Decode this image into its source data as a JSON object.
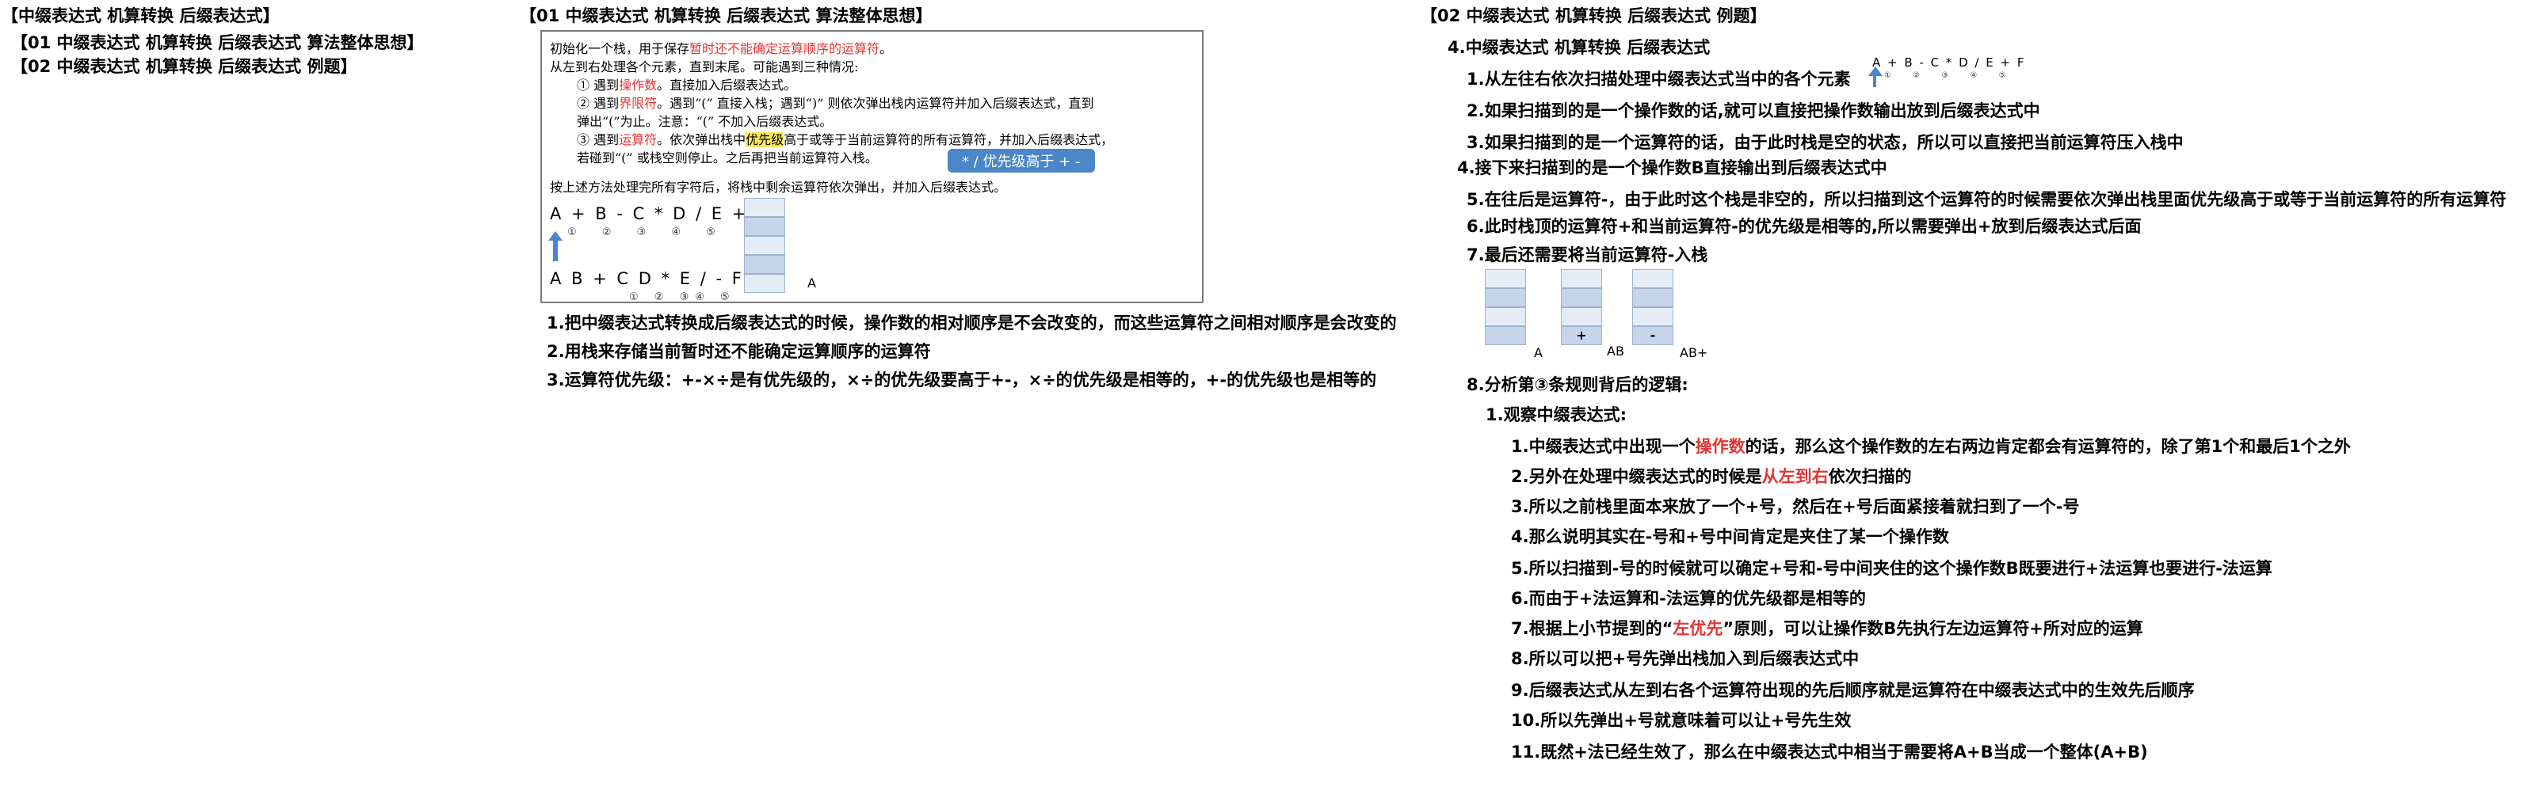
{
  "left": {
    "title": "【中缀表达式 机算转换 后缀表达式】",
    "items": [
      "【01 中缀表达式 机算转换 后缀表达式 算法整体思想】",
      "【02 中缀表达式 机算转换 后缀表达式 例题】"
    ]
  },
  "mid": {
    "title": "【01 中缀表达式 机算转换 后缀表达式 算法整体思想】",
    "panel": {
      "l1a": "初始化一个栈，用于保存",
      "l1b": "暂时还不能确定运算顺序的运算符",
      "l1c": "。",
      "l2": "从左到右处理各个元素，直到末尾。可能遇到三种情况:",
      "l3a": "① 遇到",
      "l3b": "操作数",
      "l3c": "。直接加入后缀表达式。",
      "l4a": "② 遇到",
      "l4b": "界限符",
      "l4c": "。遇到“(” 直接入栈；遇到“)” 则依次弹出栈内运算符并加入后缀表达式，直到",
      "l5": "弹出“(”为止。注意：“(” 不加入后缀表达式。",
      "l6a": "③ 遇到",
      "l6b": "运算符",
      "l6c": "。依次弹出栈中",
      "l6d": "优先级",
      "l6e": "高于或等于当前运算符的所有运算符，并加入后缀表达式，",
      "l7": "若碰到“(” 或栈空则停止。之后再把当前运算符入栈。",
      "tip": "* / 优先级高于 + -",
      "l8": "按上述方法处理完所有字符后，将栈中剩余运算符依次弹出，并加入后缀表达式。",
      "expr1": "A + B - C * D / E + F",
      "expr1_marks": "① ② ③ ④ ⑤",
      "expr2": "A B + C D * E / - F +",
      "expr2_marks": "① ② ③④ ⑤",
      "stack_label": "A"
    },
    "notes": [
      "1.把中缀表达式转换成后缀表达式的时候，操作数的相对顺序是不会改变的，而这些运算符之间相对顺序是会改变的",
      "2.用栈来存储当前暂时还不能确定运算顺序的运算符",
      "3.运算符优先级：+-×÷是有优先级的，×÷的优先级要高于+-，×÷的优先级是相等的，+-的优先级也是相等的"
    ]
  },
  "right": {
    "title": "【02 中缀表达式 机算转换 后缀表达式 例题】",
    "h4": "4.中缀表达式 机算转换 后缀表达式",
    "s1": "1.从左往右依次扫描处理中缀表达式当中的各个元素",
    "mini_expr": "A + B - C * D / E + F",
    "mini_marks": "① ② ③ ④ ⑤",
    "s2": "2.如果扫描到的是一个操作数的话,就可以直接把操作数输出放到后缀表达式中",
    "s3": "3.如果扫描到的是一个运算符的话，由于此时栈是空的状态，所以可以直接把当前运算符压入栈中",
    "s4": "4.接下来扫描到的是一个操作数B直接输出到后缀表达式中",
    "s5": "5.在往后是运算符-，由于此时这个栈是非空的，所以扫描到这个运算符的时候需要依次弹出栈里面优先级高于或等于当前运算符的所有运算符",
    "s6": "6.此时栈顶的运算符+和当前运算符-的优先级是相等的,所以需要弹出+放到后缀表达式后面",
    "s7": "7.最后还需要将当前运算符-入栈",
    "stk1_label": "A",
    "stk2_top": "+",
    "stk2_label": "AB",
    "stk3_top": "-",
    "stk3_label": "AB+",
    "s8": "8.分析第③条规则背后的逻辑:",
    "s8_1": "1.观察中缀表达式:",
    "d1a": "1.中缀表达式中出现一个",
    "d1b": "操作数",
    "d1c": "的话，那么这个操作数的左右两边肯定都会有运算符的，除了第1个和最后1个之外",
    "d2a": "2.另外在处理中缀表达式的时候是",
    "d2b": "从左到右",
    "d2c": "依次扫描的",
    "d3": "3.所以之前栈里面本来放了一个+号，然后在+号后面紧接着就扫到了一个-号",
    "d4": "4.那么说明其实在-号和+号中间肯定是夹住了某一个操作数",
    "d5": "5.所以扫描到-号的时候就可以确定+号和-号中间夹住的这个操作数B既要进行+法运算也要进行-法运算",
    "d6": "6.而由于+法运算和-法运算的优先级都是相等的",
    "d7a": "7.根据上小节提到的“",
    "d7b": "左优先",
    "d7c": "”原则，可以让操作数B先执行左边运算符+所对应的运算",
    "d8": "8.所以可以把+号先弹出栈加入到后缀表达式中",
    "d9": "9.后缀表达式从左到右各个运算符出现的先后顺序就是运算符在中缀表达式中的生效先后顺序",
    "d10": "10.所以先弹出+号就意味着可以让+号先生效",
    "d11": "11.既然+法已经生效了，那么在中缀表达式中相当于需要将A+B当成一个整体(A+B)"
  }
}
